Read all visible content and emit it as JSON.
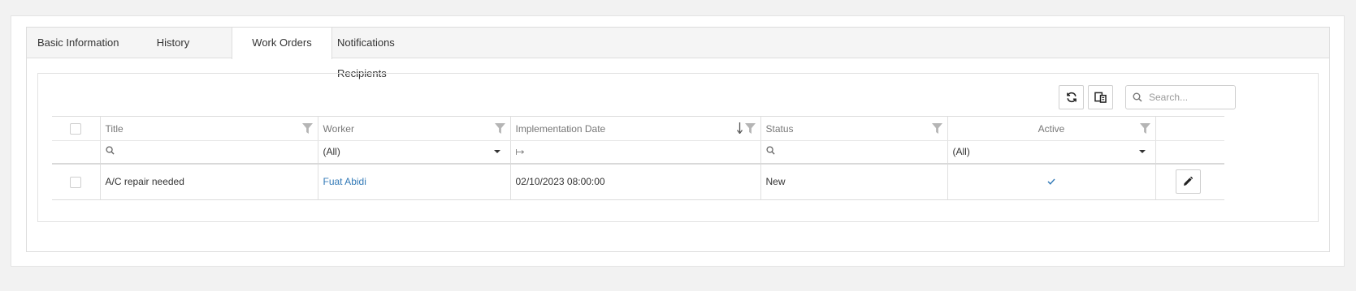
{
  "tabs": [
    {
      "label": "Basic Information"
    },
    {
      "label": "History"
    },
    {
      "label": "Work Orders"
    },
    {
      "label": "Notifications Recipients"
    }
  ],
  "active_tab": "Work Orders",
  "toolbar": {
    "refresh_icon": "refresh-icon",
    "column_chooser_icon": "column-chooser-icon",
    "search_placeholder": "Search..."
  },
  "grid": {
    "columns": [
      {
        "label": ""
      },
      {
        "label": "Title"
      },
      {
        "label": "Worker"
      },
      {
        "label": "Implementation Date"
      },
      {
        "label": "Status"
      },
      {
        "label": "Active"
      },
      {
        "label": ""
      }
    ],
    "filters": {
      "worker": "(All)",
      "active": "(All)"
    },
    "rows": [
      {
        "title": "A/C repair needed",
        "worker": "Fuat Abidi",
        "implementation_date": "02/10/2023 08:00:00",
        "status": "New",
        "active": true
      }
    ]
  },
  "colors": {
    "link": "#337ab7",
    "check": "#337ab7",
    "tab_bar_bg": "#f5f5f5",
    "page_bg": "#f2f2f2"
  }
}
